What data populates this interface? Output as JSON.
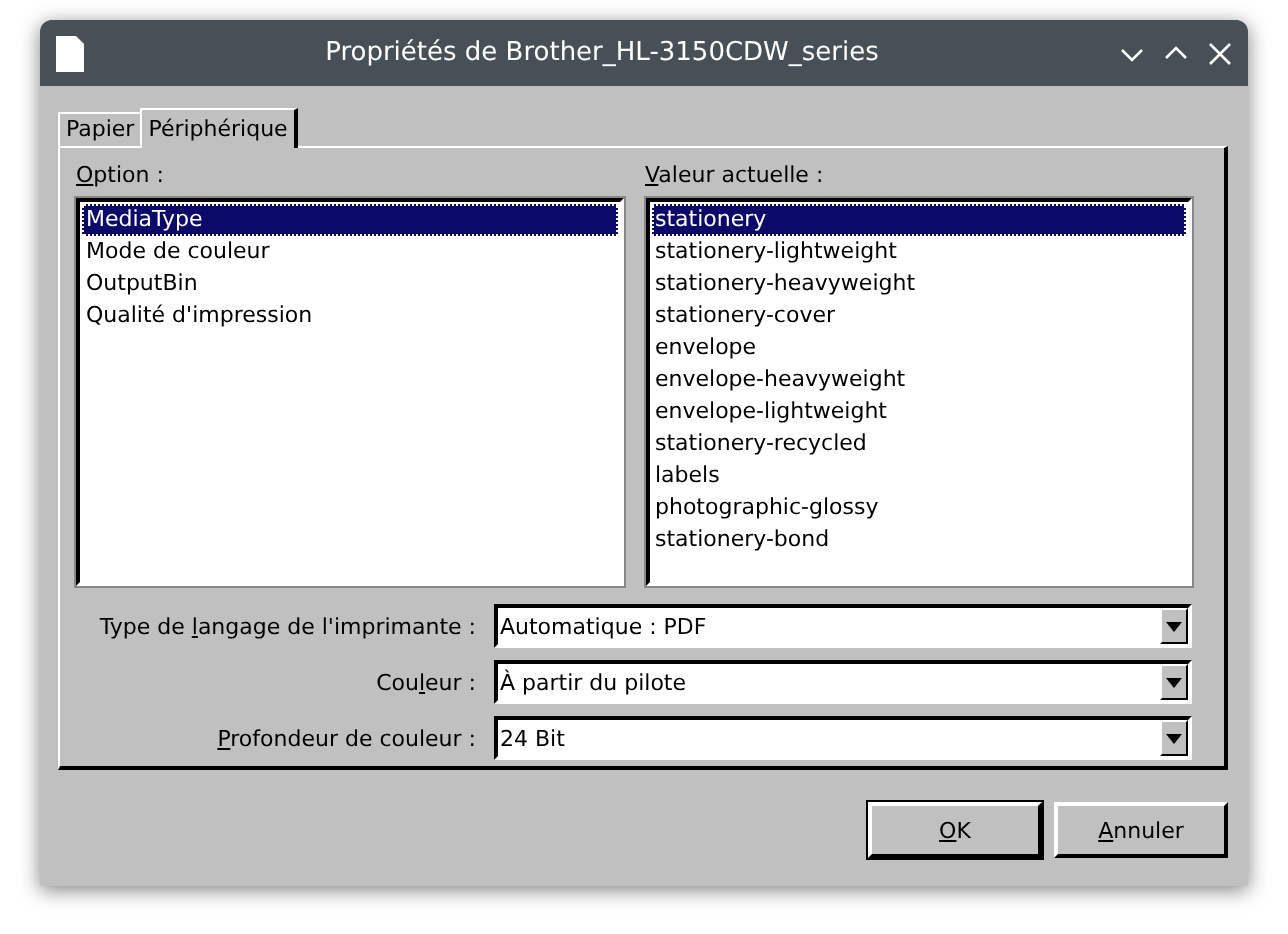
{
  "window": {
    "title": "Propriétés de Brother_HL-3150CDW_series"
  },
  "tabs": [
    {
      "label": "Papier",
      "selected": false
    },
    {
      "label": "Périphérique",
      "selected": true
    }
  ],
  "option_list": {
    "label": {
      "mnemonic": "O",
      "after": "ption :"
    },
    "items": [
      {
        "label": "MediaType",
        "selected": true
      },
      {
        "label": "Mode de couleur",
        "selected": false
      },
      {
        "label": "OutputBin",
        "selected": false
      },
      {
        "label": "Qualité d'impression",
        "selected": false
      }
    ]
  },
  "value_list": {
    "label": {
      "mnemonic": "V",
      "after": "aleur actuelle :"
    },
    "items": [
      {
        "label": "stationery",
        "selected": true
      },
      {
        "label": "stationery-lightweight",
        "selected": false
      },
      {
        "label": "stationery-heavyweight",
        "selected": false
      },
      {
        "label": "stationery-cover",
        "selected": false
      },
      {
        "label": "envelope",
        "selected": false
      },
      {
        "label": "envelope-heavyweight",
        "selected": false
      },
      {
        "label": "envelope-lightweight",
        "selected": false
      },
      {
        "label": "stationery-recycled",
        "selected": false
      },
      {
        "label": "labels",
        "selected": false
      },
      {
        "label": "photographic-glossy",
        "selected": false
      },
      {
        "label": "stationery-bond",
        "selected": false
      }
    ]
  },
  "fields": [
    {
      "label": {
        "before": "Type de ",
        "mnemonic": "l",
        "after": "angage de l'imprimante :"
      },
      "value": "Automatique : PDF"
    },
    {
      "label": {
        "before": "Cou",
        "mnemonic": "l",
        "after": "eur :"
      },
      "value": "À partir du pilote"
    },
    {
      "label": {
        "mnemonic": "P",
        "after": "rofondeur de couleur :"
      },
      "value": "24 Bit"
    }
  ],
  "buttons": [
    {
      "label": {
        "mnemonic": "O",
        "after": "K"
      }
    },
    {
      "label": {
        "mnemonic": "A",
        "after": "nnuler"
      }
    }
  ]
}
